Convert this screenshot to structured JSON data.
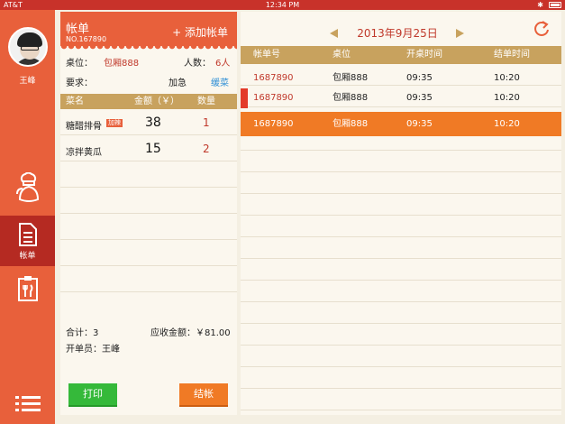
{
  "status": {
    "carrier": "AT&T",
    "time": "12:34 PM"
  },
  "user": {
    "name": "王峰"
  },
  "nav": {
    "bill_label": "帐单"
  },
  "bill": {
    "title": "帐单",
    "number": "NO.167890",
    "add_label": "+ 添加帐单",
    "table_label": "桌位：",
    "table_value": "包厢888",
    "people_label": "人数：",
    "people_value": "6人",
    "request_label": "要求：",
    "urgent_label": "加急",
    "slow_label": "缓菜",
    "headers": {
      "name": "菜名",
      "amount": "金额（￥）",
      "qty": "数量"
    },
    "dishes": [
      {
        "name": "糖醋排骨",
        "tag": "加辣",
        "price": "38",
        "qty": "1"
      },
      {
        "name": "凉拌黄瓜",
        "tag": "",
        "price": "15",
        "qty": "2"
      }
    ],
    "total_label": "合计：3",
    "amount_label": "应收金额：￥81.00",
    "opener_label": "开单员：王峰",
    "print_label": "打印",
    "settle_label": "结帐"
  },
  "orders": {
    "date": "2013年9月25日",
    "headers": {
      "no": "帐单号",
      "table": "桌位",
      "open": "开桌时间",
      "close": "结单时间"
    },
    "rows": [
      {
        "no": "1687890",
        "table": "包厢888",
        "open": "09:35",
        "close": "10:20"
      },
      {
        "no": "1687890",
        "table": "包厢888",
        "open": "09:35",
        "close": "10:20"
      },
      {
        "no": "1687890",
        "table": "包厢888",
        "open": "09:35",
        "close": "10:20"
      }
    ]
  },
  "colors": {
    "accent": "#e8603b",
    "header_gold": "#c8a25e",
    "active_row": "#f07a25",
    "print": "#35b93a"
  }
}
